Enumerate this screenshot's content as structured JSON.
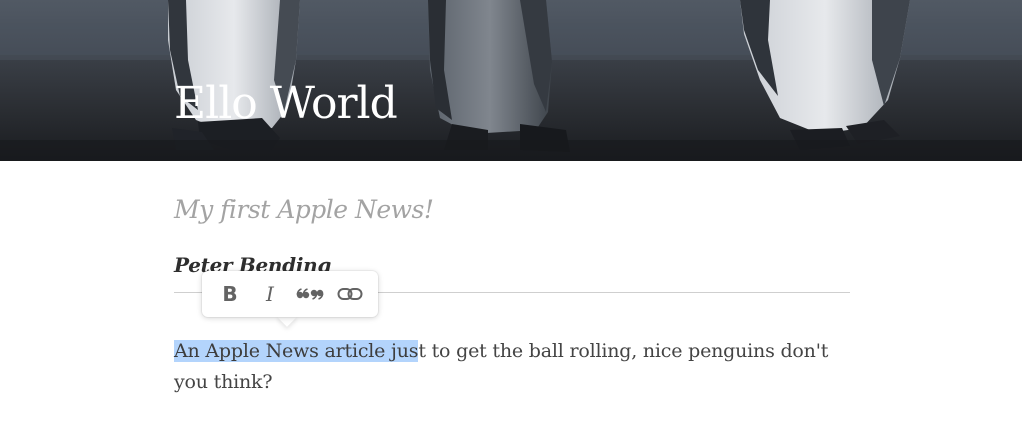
{
  "article": {
    "title": "Ello World",
    "subtitle": "My first Apple News!",
    "author": "Peter Bending",
    "body_selected": "An Apple News article jus",
    "body_rest": "t to get the ball rolling, nice penguins don't you think?"
  },
  "toolbar": {
    "buttons": [
      {
        "name": "bold",
        "label": "B",
        "icon": "bold-icon"
      },
      {
        "name": "italic",
        "label": "I",
        "icon": "italic-icon"
      },
      {
        "name": "quote",
        "icon": "quote-icon"
      },
      {
        "name": "link",
        "icon": "link-icon"
      }
    ]
  },
  "colors": {
    "selection": "#b3d4fc",
    "subtitle": "#a3a3a3",
    "body_text": "#444444",
    "divider": "#cfcfcf"
  }
}
